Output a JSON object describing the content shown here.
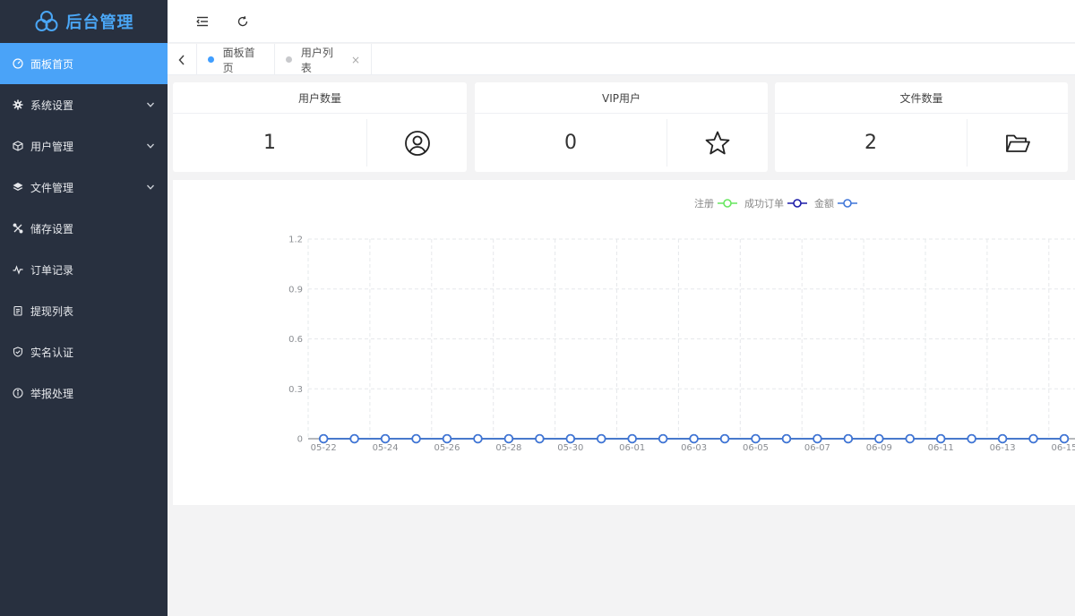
{
  "brand": {
    "title": "后台管理",
    "color": "#4aa6f5"
  },
  "sidebar": {
    "items": [
      {
        "label": "面板首页",
        "icon": "dashboard-icon",
        "active": true,
        "expandable": false
      },
      {
        "label": "系统设置",
        "icon": "gear-icon",
        "active": false,
        "expandable": true
      },
      {
        "label": "用户管理",
        "icon": "cube-icon",
        "active": false,
        "expandable": true
      },
      {
        "label": "文件管理",
        "icon": "layers-icon",
        "active": false,
        "expandable": true
      },
      {
        "label": "储存设置",
        "icon": "tools-icon",
        "active": false,
        "expandable": false
      },
      {
        "label": "订单记录",
        "icon": "activity-icon",
        "active": false,
        "expandable": false
      },
      {
        "label": "提现列表",
        "icon": "clipboard-icon",
        "active": false,
        "expandable": false
      },
      {
        "label": "实名认证",
        "icon": "shield-check-icon",
        "active": false,
        "expandable": false
      },
      {
        "label": "举报处理",
        "icon": "info-icon",
        "active": false,
        "expandable": false
      }
    ]
  },
  "topbar": {
    "buttons": [
      "collapse-menu-icon",
      "refresh-icon"
    ]
  },
  "tabs": [
    {
      "label": "面板首页",
      "active": true,
      "dot_color": "#409eff"
    },
    {
      "label": "用户列表",
      "active": false,
      "dot_color": "#c8c9cc",
      "close": "×"
    }
  ],
  "cards": [
    {
      "title": "用户数量",
      "value": "1",
      "icon": "user-circle-icon"
    },
    {
      "title": "VIP用户",
      "value": "0",
      "icon": "star-icon"
    },
    {
      "title": "文件数量",
      "value": "2",
      "icon": "folder-open-icon"
    }
  ],
  "chart_data": {
    "type": "line",
    "legend_position": "top",
    "series": [
      {
        "name": "注册",
        "color": "#67e65f",
        "values": [
          0,
          0,
          0,
          0,
          0,
          0,
          0,
          0,
          0,
          0,
          0,
          0,
          0,
          0,
          0,
          0,
          0,
          0,
          0,
          0,
          0,
          0,
          0,
          0,
          0
        ]
      },
      {
        "name": "成功订单",
        "color": "#1b1ba8",
        "values": [
          0,
          0,
          0,
          0,
          0,
          0,
          0,
          0,
          0,
          0,
          0,
          0,
          0,
          0,
          0,
          0,
          0,
          0,
          0,
          0,
          0,
          0,
          0,
          0,
          0
        ]
      },
      {
        "name": "金额",
        "color": "#3f75d8",
        "values": [
          0,
          0,
          0,
          0,
          0,
          0,
          0,
          0,
          0,
          0,
          0,
          0,
          0,
          0,
          0,
          0,
          0,
          0,
          0,
          0,
          0,
          0,
          0,
          0,
          0
        ]
      }
    ],
    "x": [
      "05-22",
      "05-23",
      "05-24",
      "05-25",
      "05-26",
      "05-27",
      "05-28",
      "05-29",
      "05-30",
      "05-31",
      "06-01",
      "06-02",
      "06-03",
      "06-04",
      "06-05",
      "06-06",
      "06-07",
      "06-08",
      "06-09",
      "06-10",
      "06-11",
      "06-12",
      "06-13",
      "06-14",
      "06-15"
    ],
    "x_tick_labels": [
      "05-22",
      "",
      "05-24",
      "",
      "05-26",
      "",
      "05-28",
      "",
      "05-30",
      "",
      "06-01",
      "",
      "06-03",
      "",
      "06-05",
      "",
      "06-07",
      "",
      "06-09",
      "",
      "06-11",
      "",
      "06-13",
      "",
      "06-15"
    ],
    "y_ticks": [
      "0",
      "0.3",
      "0.6",
      "0.9",
      "1.2"
    ],
    "ylim": [
      0,
      1.2
    ],
    "grid": true
  }
}
